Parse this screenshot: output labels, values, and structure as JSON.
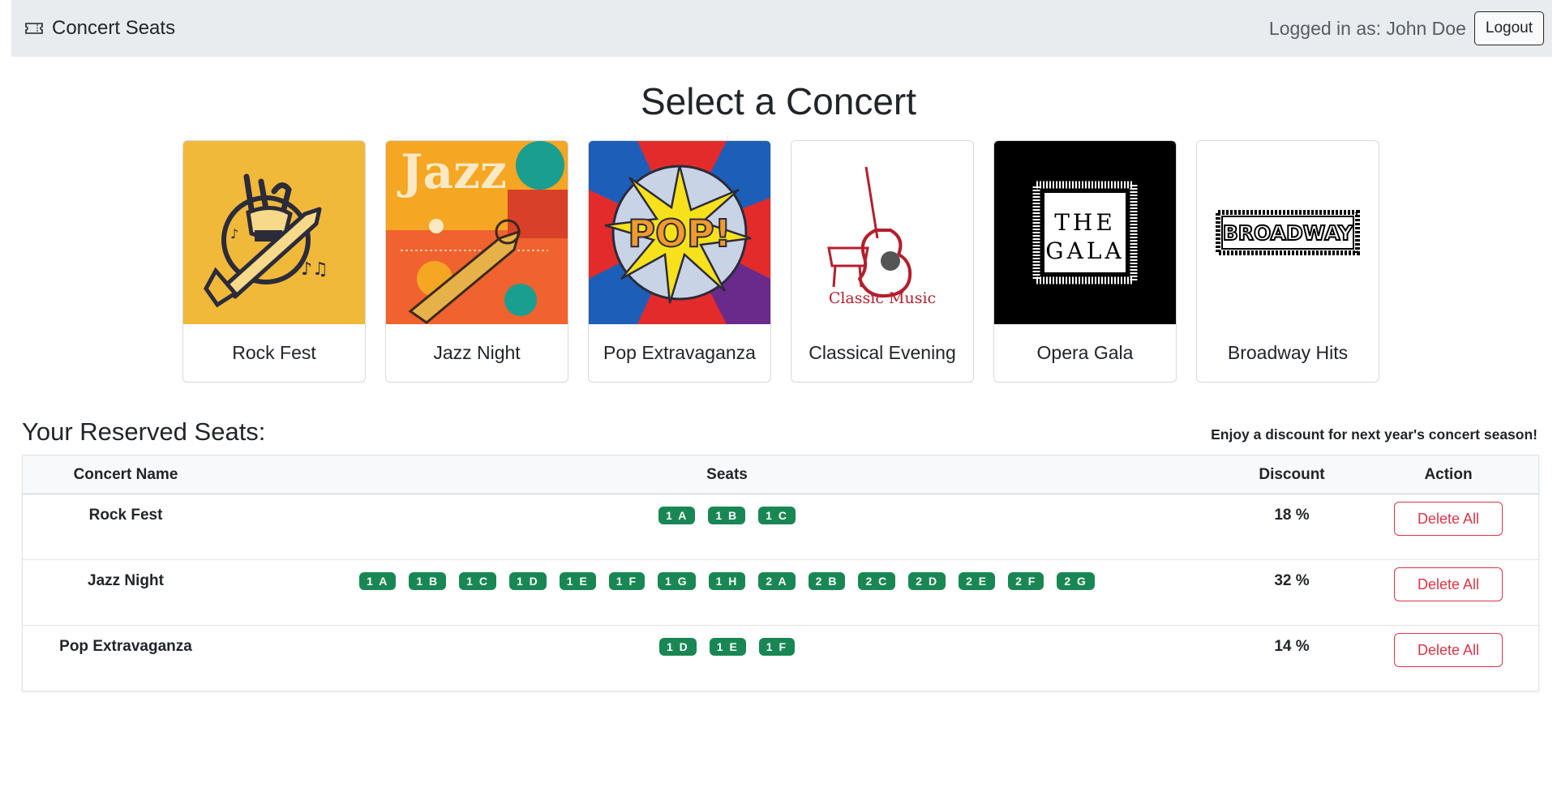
{
  "navbar": {
    "brand_icon": "ticket-icon",
    "brand_label": "Concert Seats",
    "user_text": "Logged in as: John Doe",
    "logout_label": "Logout"
  },
  "page_title": "Select a Concert",
  "concerts": [
    {
      "title": "Rock Fest",
      "image_icon": "rock-hand-guitar-illustration",
      "image_text": ""
    },
    {
      "title": "Jazz Night",
      "image_icon": "jazz-trumpet-poster",
      "image_text": "Jazz"
    },
    {
      "title": "Pop Extravaganza",
      "image_icon": "pop-comic-burst",
      "image_text": "POP!"
    },
    {
      "title": "Classical Evening",
      "image_icon": "violin-piano-logo",
      "image_text": "Classic Music"
    },
    {
      "title": "Opera Gala",
      "image_icon": "opera-gala-frame",
      "image_text": "THE GALA"
    },
    {
      "title": "Broadway Hits",
      "image_icon": "broadway-marquee",
      "image_text": "BROADWAY"
    }
  ],
  "reserved": {
    "title": "Your Reserved Seats:",
    "discount_note": "Enjoy a discount for next year's concert season!",
    "headers": {
      "name": "Concert Name",
      "seats": "Seats",
      "discount": "Discount",
      "action": "Action"
    },
    "rows": [
      {
        "name": "Rock Fest",
        "seats": [
          "1 A",
          "1 B",
          "1 C"
        ],
        "discount": "18 %",
        "action": "Delete All"
      },
      {
        "name": "Jazz Night",
        "seats": [
          "1 A",
          "1 B",
          "1 C",
          "1 D",
          "1 E",
          "1 F",
          "1 G",
          "1 H",
          "2 A",
          "2 B",
          "2 C",
          "2 D",
          "2 E",
          "2 F",
          "2 G"
        ],
        "discount": "32 %",
        "action": "Delete All"
      },
      {
        "name": "Pop Extravaganza",
        "seats": [
          "1 D",
          "1 E",
          "1 F"
        ],
        "discount": "14 %",
        "action": "Delete All"
      }
    ]
  },
  "colors": {
    "navbar_bg": "#e9ecef",
    "seat_badge": "#198754",
    "danger": "#dc3545",
    "rock_bg": "#f0b93a",
    "opera_bg": "#000000"
  }
}
